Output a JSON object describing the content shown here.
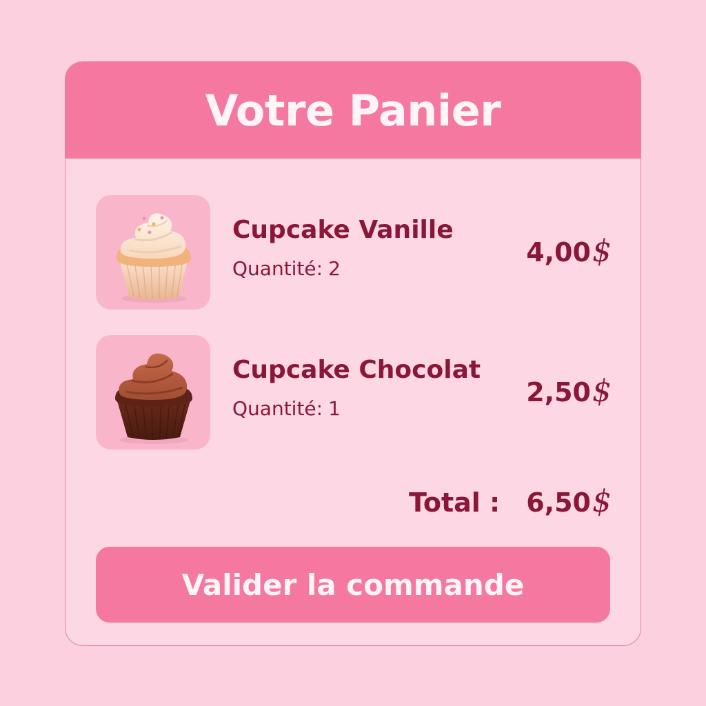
{
  "cart": {
    "title": "Votre Panier",
    "quantity_label": "Quantité:",
    "items": [
      {
        "name": "Cupcake Vanille",
        "quantity": "2",
        "price": "4,00",
        "currency": "$",
        "image": "vanilla-cupcake"
      },
      {
        "name": "Cupcake Chocolat",
        "quantity": "1",
        "price": "2,50",
        "currency": "$",
        "image": "chocolate-cupcake"
      }
    ],
    "total_label": "Total :",
    "total_value": "6,50",
    "total_currency": "$",
    "checkout_label": "Valider la commande"
  },
  "colors": {
    "background": "#fcd0de",
    "card": "#fdd7e3",
    "accent": "#f4789f",
    "text": "#8a1738"
  }
}
